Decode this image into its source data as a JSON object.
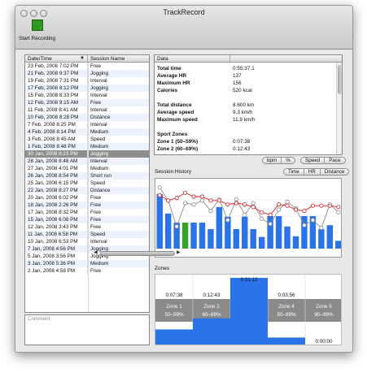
{
  "window": {
    "title": "TrackRecord"
  },
  "toolbar": {
    "start_label": "Start Recording"
  },
  "sessions": {
    "columns": [
      "Date/Time",
      "Session Name"
    ],
    "rows": [
      {
        "date": "23 Feb, 2008 7:02 PM",
        "name": "Free"
      },
      {
        "date": "21 Feb, 2008 9:37 PM",
        "name": "Jogging"
      },
      {
        "date": "19 Feb, 2008 7:31 PM",
        "name": "Interval"
      },
      {
        "date": "17 Feb, 2008 8:12 PM",
        "name": "Jogging"
      },
      {
        "date": "15 Feb, 2008 8:33 PM",
        "name": "Interval"
      },
      {
        "date": "12 Feb, 2008 9:15 AM",
        "name": "Free"
      },
      {
        "date": "11 Feb, 2008 8:41 AM",
        "name": "Interval"
      },
      {
        "date": "10 Feb, 2008 8:28 PM",
        "name": "Distance"
      },
      {
        "date": "7 Feb, 2008 8:25 PM",
        "name": "Interval"
      },
      {
        "date": "4 Feb, 2008 8:14 PM",
        "name": "Medium"
      },
      {
        "date": "3 Feb, 2008 8:45 AM",
        "name": "Speed"
      },
      {
        "date": "1 Feb, 2008 8:48 PM",
        "name": "Medium"
      },
      {
        "date": "30 Jan, 2008 8:23 PM",
        "name": "Jogging",
        "selected": true
      },
      {
        "date": "28 Jan, 2008 8:48 AM",
        "name": "Interval"
      },
      {
        "date": "27 Jan, 2008 4:01 PM",
        "name": "Medium"
      },
      {
        "date": "26 Jan, 2008 8:54 PM",
        "name": "Short run"
      },
      {
        "date": "25 Jan, 2008 6:15 PM",
        "name": "Speed"
      },
      {
        "date": "22 Jan, 2008 8:27 PM",
        "name": "Distance"
      },
      {
        "date": "20 Jan, 2008 6:02 PM",
        "name": "Free"
      },
      {
        "date": "18 Jan, 2008 2:26 PM",
        "name": "Free"
      },
      {
        "date": "17 Jan, 2008 8:32 PM",
        "name": "Free"
      },
      {
        "date": "15 Jan, 2008 6:08 PM",
        "name": "Free"
      },
      {
        "date": "12 Jan, 2008 3:43 PM",
        "name": "Free"
      },
      {
        "date": "11 Jan, 2008 6:58 PM",
        "name": "Speed"
      },
      {
        "date": "10 Jan, 2008 6:53 PM",
        "name": "Interval"
      },
      {
        "date": "7 Jan, 2008 4:56 PM",
        "name": "Jogging"
      },
      {
        "date": "5 Jan, 2008 3:56 PM",
        "name": "Jogging"
      },
      {
        "date": "3 Jan, 2008 5:36 PM",
        "name": "Medium"
      },
      {
        "date": "2 Jan, 2008 4:58 PM",
        "name": "Free"
      }
    ]
  },
  "comment": {
    "placeholder": "Comment"
  },
  "data_panel": {
    "header": "Data",
    "items": [
      {
        "label": "Total time",
        "value": "0:55:37.1"
      },
      {
        "label": "Average HR",
        "value": "137"
      },
      {
        "label": "Maximum HR",
        "value": "156"
      },
      {
        "label": "Calories",
        "value": "520 kcal"
      },
      {
        "label": "Total distance",
        "value": "8.600 km"
      },
      {
        "label": "Average speed",
        "value": "9.3 km/h"
      },
      {
        "label": "Maximum speed",
        "value": "11.9 km/h"
      },
      {
        "label": "Sport Zones",
        "value": ""
      },
      {
        "label": "Zone 1  (50–59%)",
        "value": "0:07:38"
      },
      {
        "label": "Zone 2  (60–69%)",
        "value": "0:12:43"
      }
    ]
  },
  "hr_toggle": [
    "bpm",
    "%"
  ],
  "speed_toggle": [
    "Speed",
    "Pace"
  ],
  "history": {
    "title": "Session History",
    "tabs": [
      "Time",
      "HR",
      "Distance"
    ]
  },
  "zones_panel": {
    "title": "Zones"
  },
  "chart_data": [
    {
      "type": "bar",
      "title": "Session History",
      "bar_color": "#2a73e8",
      "highlight_color": "#3aa22a",
      "highlight_index": 3,
      "bars": [
        0.84,
        0.54,
        0.4,
        0.4,
        0.4,
        0.4,
        0.3,
        0.64,
        0.49,
        0.3,
        0.49,
        0.3,
        0.18,
        0.5,
        0.5,
        0.34,
        0.19,
        0.5,
        0.5,
        0.3,
        0.36,
        0.12
      ],
      "line_hr": [
        0.82,
        0.74,
        0.78,
        0.86,
        0.8,
        0.8,
        0.74,
        0.74,
        0.68,
        0.7,
        0.68,
        0.64,
        0.56,
        0.52,
        0.68,
        0.66,
        0.6,
        0.58,
        0.66,
        0.66,
        0.66,
        0.64
      ],
      "line_other": [
        0.94,
        0.74,
        0.34,
        0.7,
        0.68,
        0.74,
        0.58,
        0.76,
        0.44,
        0.76,
        0.52,
        0.7,
        0.46,
        0.38,
        0.6,
        0.72,
        0.62,
        0.36,
        0.44,
        0.32,
        0.68,
        0.56
      ]
    },
    {
      "type": "bar",
      "title": "Zones",
      "categories": [
        "Zone 1 50–59%",
        "Zone 2 60–69%",
        "Zone 3 70–79%",
        "Zone 4 80–89%",
        "Zone 5 90–99%"
      ],
      "zone_names": [
        "Zone 1",
        "Zone 2",
        "Zone 3",
        "Zone 4",
        "Zone 5"
      ],
      "zone_ranges": [
        "50–59%",
        "60–69%",
        "70–79%",
        "80–89%",
        "90–99%"
      ],
      "labels": [
        "0:07:38",
        "0:12:43",
        "0:31:12",
        "0:03:56",
        "0:00:00"
      ],
      "values_minutes": [
        7.63,
        12.72,
        31.2,
        3.93,
        0
      ]
    }
  ]
}
